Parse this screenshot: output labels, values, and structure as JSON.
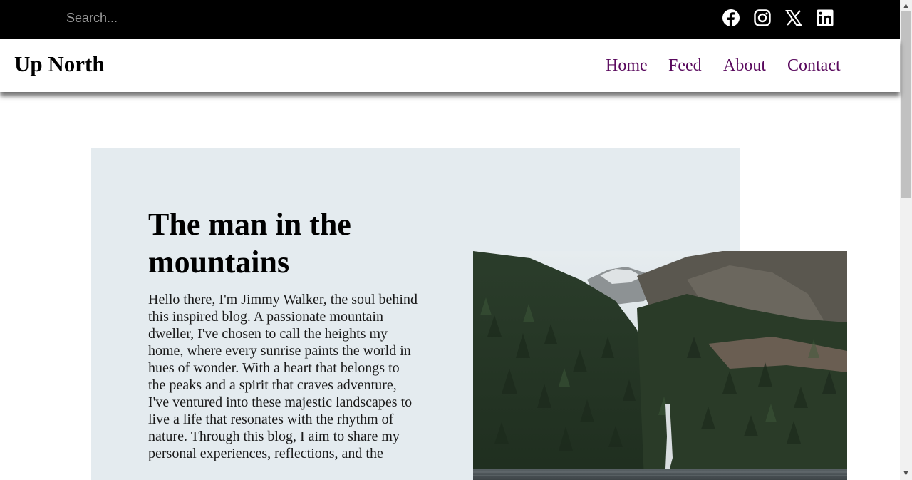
{
  "topbar": {
    "search": {
      "placeholder": "Search..."
    },
    "social": [
      {
        "icon": "facebook-icon"
      },
      {
        "icon": "instagram-icon"
      },
      {
        "icon": "x-icon"
      },
      {
        "icon": "linkedin-icon"
      }
    ]
  },
  "header": {
    "brand": "Up North",
    "nav": [
      {
        "label": "Home"
      },
      {
        "label": "Feed"
      },
      {
        "label": "About"
      },
      {
        "label": "Contact"
      }
    ],
    "nav_color": "#5a0a5e"
  },
  "hero": {
    "title": "The man in the mountains",
    "text": "Hello there, I'm Jimmy Walker, the soul behind this inspired blog. A passionate mountain dweller, I've chosen to call the heights my home, where every sunrise paints the world in hues of wonder. With a heart that belongs to the peaks and a spirit that craves adventure, I've ventured into these majestic landscapes to live a life that resonates with the rhythm of nature. Through this blog, I aim to share my personal experiences, reflections, and the",
    "background": "#e4ebef",
    "image": "mountain-waterfall-photo"
  }
}
